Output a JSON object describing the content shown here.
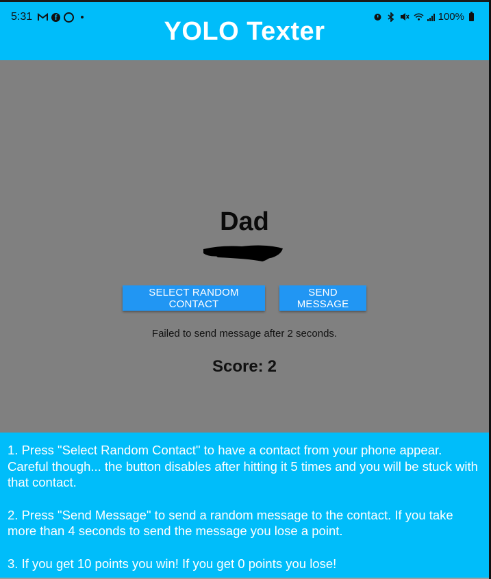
{
  "status_bar": {
    "time": "5:31",
    "icons_left": [
      "gmail-icon",
      "facebook-icon",
      "whatsapp-icon",
      "notification-dot-icon"
    ],
    "icons_right": [
      "alarm-icon",
      "bluetooth-icon",
      "mute-icon",
      "wifi-icon",
      "signal-icon",
      "battery-icon"
    ],
    "battery": "100%"
  },
  "header": {
    "title": "YOLO Texter",
    "color": "#00bdfa"
  },
  "main": {
    "contact_name": "Dad",
    "select_button": "SELECT RANDOM CONTACT",
    "send_button": "SEND MESSAGE",
    "status_message": "Failed to send message after 2 seconds.",
    "score_label": "Score:",
    "score_value": "2",
    "background": "#808080",
    "button_color": "#2196f3"
  },
  "instructions": {
    "step1": "1. Press \"Select Random Contact\" to have a contact from your phone appear. Careful though... the button disables after hitting it 5 times and you will be stuck with that contact.",
    "step2": "2. Press \"Send Message\" to send a random message to the contact. If you take more than 4 seconds to send the message you lose a point.",
    "step3": "3. If you get 10 points you win! If you get 0 points you lose!"
  }
}
